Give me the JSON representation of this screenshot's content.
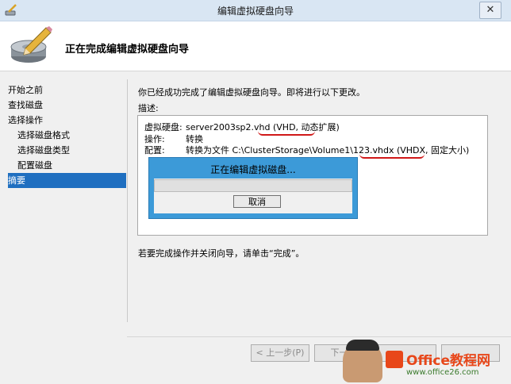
{
  "window": {
    "title": "编辑虚拟硬盘向导",
    "close_glyph": "✕"
  },
  "header": {
    "title": "正在完成编辑虚拟硬盘向导",
    "icon": "disk-wizard-icon"
  },
  "nav": {
    "items": [
      {
        "label": "开始之前"
      },
      {
        "label": "查找磁盘"
      },
      {
        "label": "选择操作"
      },
      {
        "label": "选择磁盘格式"
      },
      {
        "label": "选择磁盘类型"
      },
      {
        "label": "配置磁盘"
      },
      {
        "label": "摘要"
      }
    ],
    "selected_index": 6
  },
  "main": {
    "intro": "你已经成功完成了编辑虚拟硬盘向导。即将进行以下更改。",
    "description_label": "描述:",
    "summary": [
      {
        "key": "虚拟硬盘:",
        "value": "server2003sp2.vhd (VHD, 动态扩展)"
      },
      {
        "key": "操作:",
        "value": "转换"
      },
      {
        "key": "配置:",
        "value": "转换为文件 C:\\ClusterStorage\\Volume1\\123.vhdx (VHDX, 固定大小)"
      }
    ],
    "finish_note": "若要完成操作并关闭向导，请单击“完成”。"
  },
  "progress_dialog": {
    "title": "正在编辑虚拟磁盘...",
    "cancel_label": "取消",
    "progress": 0
  },
  "footer": {
    "prev_label": "< 上一步(P)",
    "next_label": "下一步",
    "finish_label": "",
    "cancel_label": ""
  },
  "watermark": {
    "title": "Office教程网",
    "url": "www.office26.com"
  },
  "colors": {
    "selected_nav": "#1f6fc0",
    "annotation": "#d01818",
    "progress_frame": "#3c9ad8"
  }
}
